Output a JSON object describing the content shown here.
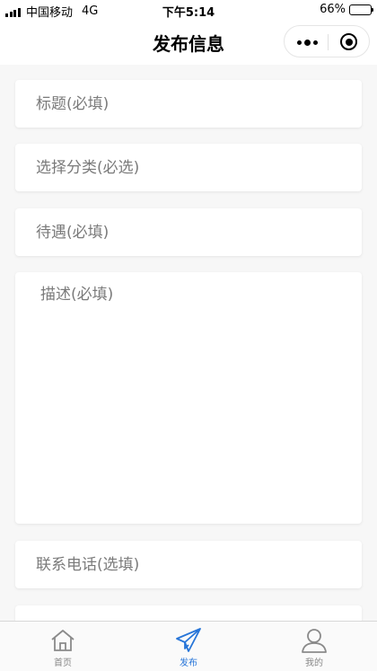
{
  "status_bar": {
    "carrier": "中国移动",
    "network": "4G",
    "time": "下午5:14",
    "battery_percent": "66%",
    "battery_level": 0.66
  },
  "nav": {
    "title": "发布信息"
  },
  "form": {
    "title_placeholder": "标题(必填)",
    "category_placeholder": "选择分类(必选)",
    "salary_placeholder": "待遇(必填)",
    "description_placeholder": "描述(必填)",
    "phone_placeholder": "联系电话(选填)"
  },
  "tab_bar": {
    "items": [
      {
        "label": "首页",
        "icon": "home-icon",
        "active": false
      },
      {
        "label": "发布",
        "icon": "paper-plane-icon",
        "active": true
      },
      {
        "label": "我的",
        "icon": "user-icon",
        "active": false
      }
    ],
    "active_color": "#2775d8",
    "inactive_color": "#888888"
  }
}
